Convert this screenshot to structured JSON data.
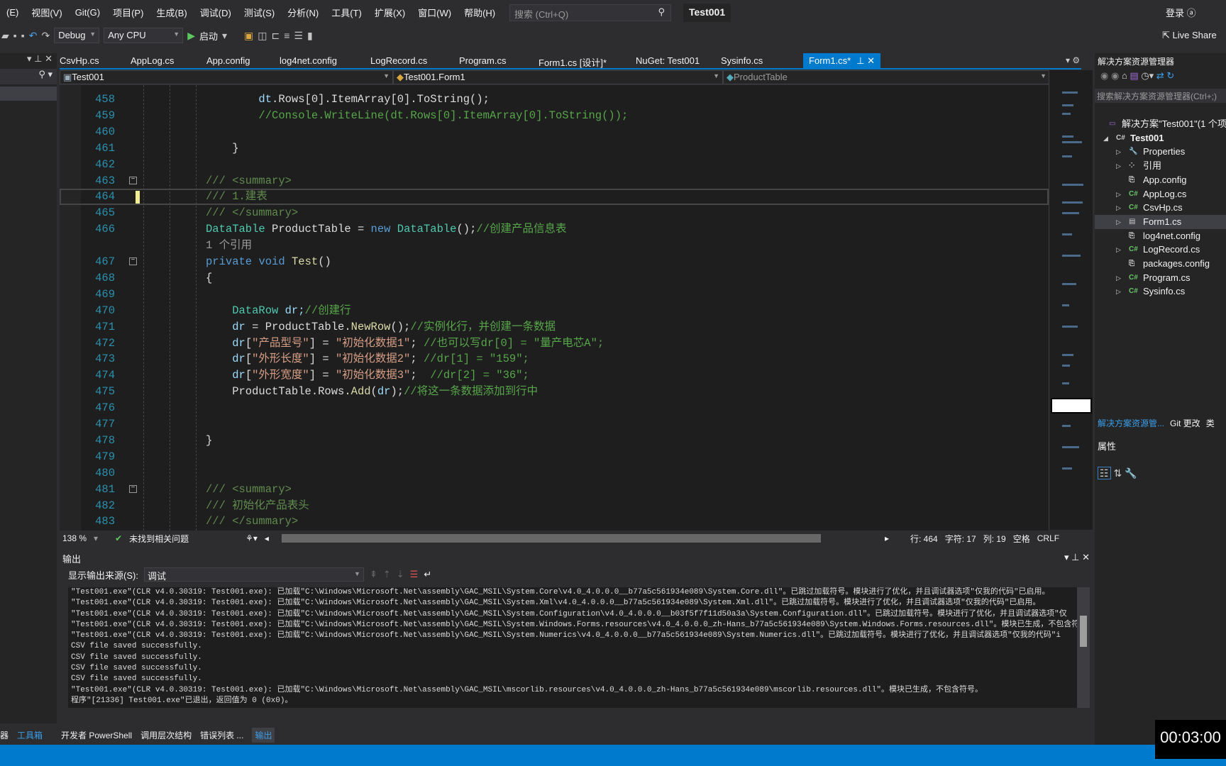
{
  "menu": [
    "(E)",
    "视图(V)",
    "Git(G)",
    "项目(P)",
    "生成(B)",
    "调试(D)",
    "测试(S)",
    "分析(N)",
    "工具(T)",
    "扩展(X)",
    "窗口(W)",
    "帮助(H)"
  ],
  "search": {
    "placeholder": "搜索 (Ctrl+Q)"
  },
  "title": "Test001",
  "login": "登录",
  "toolbar": {
    "config": "Debug",
    "platform": "Any CPU",
    "start": "启动",
    "live_share": "Live Share"
  },
  "tabs": [
    "CsvHp.cs",
    "AppLog.cs",
    "App.config",
    "log4net.config",
    "LogRecord.cs",
    "Program.cs",
    "Form1.cs [设计]*",
    "NuGet: Test001",
    "Sysinfo.cs",
    "Form1.cs*"
  ],
  "navbar": {
    "project": "Test001",
    "class": "Test001.Form1",
    "member": "ProductTable"
  },
  "code": [
    {
      "n": "458",
      "t": [
        [
          "        dt",
          "va"
        ],
        [
          ".Rows[0].ItemArray[0].ToString();",
          "id"
        ]
      ]
    },
    {
      "n": "459",
      "t": [
        [
          "        //Console.WriteLine(dt.Rows[0].ItemArray[0].ToString());",
          "cm"
        ]
      ]
    },
    {
      "n": "460",
      "t": []
    },
    {
      "n": "461",
      "t": [
        [
          "    }",
          "id"
        ]
      ]
    },
    {
      "n": "462",
      "t": []
    },
    {
      "n": "463",
      "fold": true,
      "t": [
        [
          "///",
          "xd"
        ],
        [
          " <summary>",
          "xd"
        ]
      ]
    },
    {
      "n": "464",
      "cur": true,
      "chg": true,
      "t": [
        [
          "/// 1.建表",
          "xd"
        ]
      ]
    },
    {
      "n": "465",
      "t": [
        [
          "/// </summary>",
          "xd"
        ]
      ]
    },
    {
      "n": "466",
      "t": [
        [
          "DataTable",
          "ty"
        ],
        [
          " ProductTable = ",
          "id"
        ],
        [
          "new",
          "kw"
        ],
        [
          " ",
          "id"
        ],
        [
          "DataTable",
          "ty"
        ],
        [
          "();",
          "id"
        ],
        [
          "//创建产品信息表",
          "cm"
        ]
      ]
    },
    {
      "n": "",
      "t": [
        [
          "1 个引用",
          "cl"
        ]
      ]
    },
    {
      "n": "467",
      "fold": true,
      "t": [
        [
          "private",
          "kw"
        ],
        [
          " ",
          "id"
        ],
        [
          "void",
          "kw"
        ],
        [
          " ",
          "id"
        ],
        [
          "Test",
          "me"
        ],
        [
          "()",
          "id"
        ]
      ]
    },
    {
      "n": "468",
      "t": [
        [
          "{",
          "id"
        ]
      ]
    },
    {
      "n": "469",
      "t": []
    },
    {
      "n": "470",
      "t": [
        [
          "    DataRow",
          "ty"
        ],
        [
          " dr;",
          "va"
        ],
        [
          "//创建行",
          "cm"
        ]
      ]
    },
    {
      "n": "471",
      "t": [
        [
          "    dr",
          "va"
        ],
        [
          " = ProductTable.",
          "id"
        ],
        [
          "NewRow",
          "me"
        ],
        [
          "();",
          "id"
        ],
        [
          "//实例化行，并创建一条数据",
          "cm"
        ]
      ]
    },
    {
      "n": "472",
      "t": [
        [
          "    dr",
          "va"
        ],
        [
          "[",
          "id"
        ],
        [
          "\"产品型号\"",
          "st"
        ],
        [
          "] = ",
          "id"
        ],
        [
          "\"初始化数据1\"",
          "st"
        ],
        [
          "; ",
          "id"
        ],
        [
          "//也可以写dr[0] = \"量产电芯A\";",
          "cm"
        ]
      ]
    },
    {
      "n": "473",
      "t": [
        [
          "    dr",
          "va"
        ],
        [
          "[",
          "id"
        ],
        [
          "\"外形长度\"",
          "st"
        ],
        [
          "] = ",
          "id"
        ],
        [
          "\"初始化数据2\"",
          "st"
        ],
        [
          "; ",
          "id"
        ],
        [
          "//dr[1] = \"159\";",
          "cm"
        ]
      ]
    },
    {
      "n": "474",
      "t": [
        [
          "    dr",
          "va"
        ],
        [
          "[",
          "id"
        ],
        [
          "\"外形宽度\"",
          "st"
        ],
        [
          "] = ",
          "id"
        ],
        [
          "\"初始化数据3\"",
          "st"
        ],
        [
          ";  ",
          "id"
        ],
        [
          "//dr[2] = \"36\";",
          "cm"
        ]
      ]
    },
    {
      "n": "475",
      "t": [
        [
          "    ProductTable.Rows.",
          "id"
        ],
        [
          "Add",
          "me"
        ],
        [
          "(",
          "id"
        ],
        [
          "dr",
          "va"
        ],
        [
          ");",
          "id"
        ],
        [
          "//将这一条数据添加到行中",
          "cm"
        ]
      ]
    },
    {
      "n": "476",
      "t": []
    },
    {
      "n": "477",
      "t": []
    },
    {
      "n": "478",
      "t": [
        [
          "}",
          "id"
        ]
      ]
    },
    {
      "n": "479",
      "t": []
    },
    {
      "n": "480",
      "t": []
    },
    {
      "n": "481",
      "fold": true,
      "t": [
        [
          "/// <summary>",
          "xd"
        ]
      ]
    },
    {
      "n": "482",
      "t": [
        [
          "/// 初始化产品表头",
          "xd"
        ]
      ]
    },
    {
      "n": "483",
      "t": [
        [
          "/// </summary>",
          "xd"
        ]
      ]
    }
  ],
  "editor_status": {
    "zoom": "138 %",
    "issues": "未找到相关问题",
    "line": "行: 464",
    "char": "字符: 17",
    "col": "列: 19",
    "spaces": "空格",
    "eol": "CRLF"
  },
  "output": {
    "title": "输出",
    "source_label": "显示输出来源(S):",
    "source": "调试",
    "lines": [
      "\"Test001.exe\"(CLR v4.0.30319: Test001.exe): 已加载\"C:\\Windows\\Microsoft.Net\\assembly\\GAC_MSIL\\System.Core\\v4.0_4.0.0.0__b77a5c561934e089\\System.Core.dll\"。已跳过加载符号。模块进行了优化，并且调试器选项\"仅我的代码\"已启用。",
      "\"Test001.exe\"(CLR v4.0.30319: Test001.exe): 已加载\"C:\\Windows\\Microsoft.Net\\assembly\\GAC_MSIL\\System.Xml\\v4.0_4.0.0.0__b77a5c561934e089\\System.Xml.dll\"。已跳过加载符号。模块进行了优化，并且调试器选项\"仅我的代码\"已启用。",
      "\"Test001.exe\"(CLR v4.0.30319: Test001.exe): 已加载\"C:\\Windows\\Microsoft.Net\\assembly\\GAC_MSIL\\System.Configuration\\v4.0_4.0.0.0__b03f5f7f11d50a3a\\System.Configuration.dll\"。已跳过加载符号。模块进行了优化，并且调试器选项\"仅",
      "\"Test001.exe\"(CLR v4.0.30319: Test001.exe): 已加载\"C:\\Windows\\Microsoft.Net\\assembly\\GAC_MSIL\\System.Windows.Forms.resources\\v4.0_4.0.0.0_zh-Hans_b77a5c561934e089\\System.Windows.Forms.resources.dll\"。模块已生成，不包含符号。",
      "\"Test001.exe\"(CLR v4.0.30319: Test001.exe): 已加载\"C:\\Windows\\Microsoft.Net\\assembly\\GAC_MSIL\\System.Numerics\\v4.0_4.0.0.0__b77a5c561934e089\\System.Numerics.dll\"。已跳过加载符号。模块进行了优化，并且调试器选项\"仅我的代码\"i",
      "CSV file saved successfully.",
      "CSV file saved successfully.",
      "CSV file saved successfully.",
      "CSV file saved successfully.",
      "\"Test001.exe\"(CLR v4.0.30319: Test001.exe): 已加载\"C:\\Windows\\Microsoft.Net\\assembly\\GAC_MSIL\\mscorlib.resources\\v4.0_4.0.0.0_zh-Hans_b77a5c561934e089\\mscorlib.resources.dll\"。模块已生成，不包含符号。",
      "程序\"[21336] Test001.exe\"已退出，返回值为 0 (0x0)。"
    ]
  },
  "bottom_tabs": {
    "left": [
      "器",
      "工具箱"
    ],
    "main": [
      "开发者 PowerShell",
      "调用层次结构",
      "错误列表 ...",
      "输出"
    ]
  },
  "solution": {
    "title": "解决方案资源管理器",
    "search": "搜索解决方案资源管理器(Ctrl+;)",
    "items": [
      {
        "label": "解决方案\"Test001\"(1 个项",
        "lvl": 0,
        "icon": "solution-icon",
        "arrow": ""
      },
      {
        "label": "Test001",
        "lvl": 1,
        "icon": "csharp-project-icon",
        "arrow": "◢",
        "bold": true
      },
      {
        "label": "Properties",
        "lvl": 2,
        "icon": "wrench-icon",
        "arrow": "▷"
      },
      {
        "label": "引用",
        "lvl": 2,
        "icon": "references-icon",
        "arrow": "▷"
      },
      {
        "label": "App.config",
        "lvl": 2,
        "icon": "config-file-icon",
        "arrow": ""
      },
      {
        "label": "AppLog.cs",
        "lvl": 2,
        "icon": "csharp-file-icon",
        "arrow": "▷"
      },
      {
        "label": "CsvHp.cs",
        "lvl": 2,
        "icon": "csharp-file-icon",
        "arrow": "▷"
      },
      {
        "label": "Form1.cs",
        "lvl": 2,
        "icon": "form-icon",
        "arrow": "▷",
        "selected": true
      },
      {
        "label": "log4net.config",
        "lvl": 2,
        "icon": "config-file-icon",
        "arrow": ""
      },
      {
        "label": "LogRecord.cs",
        "lvl": 2,
        "icon": "csharp-file-icon",
        "arrow": "▷"
      },
      {
        "label": "packages.config",
        "lvl": 2,
        "icon": "config-file-icon",
        "arrow": ""
      },
      {
        "label": "Program.cs",
        "lvl": 2,
        "icon": "csharp-file-icon",
        "arrow": "▷"
      },
      {
        "label": "Sysinfo.cs",
        "lvl": 2,
        "icon": "csharp-file-icon",
        "arrow": "▷"
      }
    ],
    "tabs": [
      "解决方案资源管...",
      "Git 更改",
      "类"
    ]
  },
  "properties": {
    "title": "属性"
  },
  "timer": "00:03:00",
  "colors": {
    "accent": "#007acc",
    "editor_bg": "#1e1e1e",
    "keyword": "#569cd6",
    "type": "#4ec9b0",
    "comment": "#57a64a",
    "string": "#d69d85"
  }
}
